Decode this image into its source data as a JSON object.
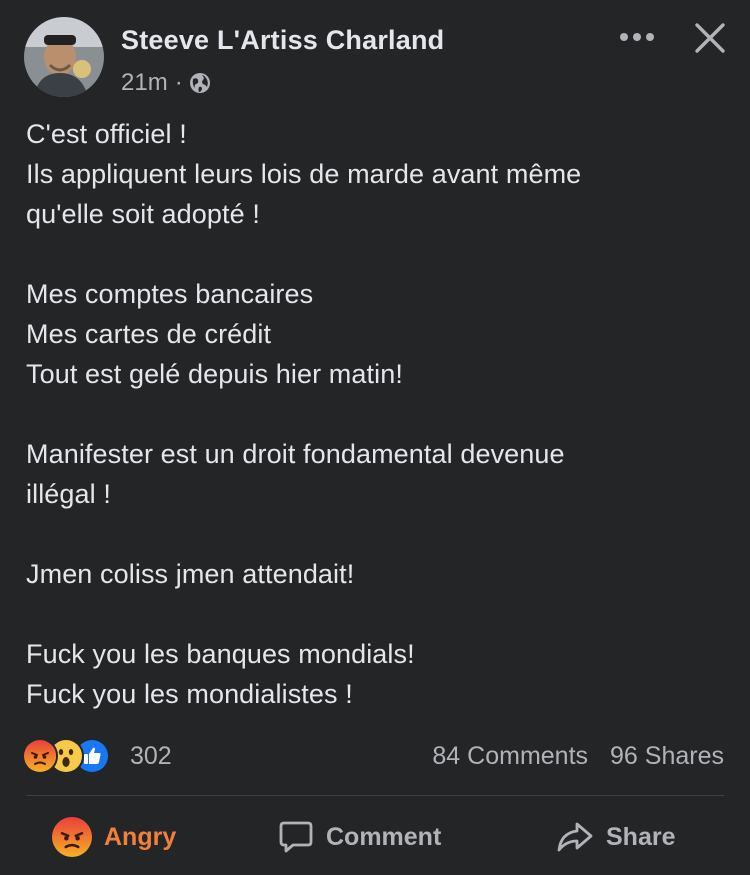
{
  "post": {
    "author": "Steeve L'Artiss Charland",
    "time": "21m",
    "separator": "·",
    "privacy_icon": "globe-icon",
    "lines": [
      "C'est officiel !",
      "Ils appliquent leurs lois de marde avant même",
      "qu'elle soit adopté !",
      "",
      "Mes comptes bancaires",
      "Mes cartes de crédit",
      "Tout est gelé depuis hier matin!",
      "",
      "Manifester est un droit fondamental devenue",
      "illégal !",
      "",
      "Jmen coliss jmen attendait!",
      "",
      "Fuck you les banques mondials!",
      "Fuck you les mondialistes !"
    ]
  },
  "engagement": {
    "reaction_icons": [
      "angry-reaction-icon",
      "wow-reaction-icon",
      "like-reaction-icon"
    ],
    "reaction_count": "302",
    "comments": "84 Comments",
    "shares": "96 Shares"
  },
  "actions": {
    "angry_label": "Angry",
    "comment_label": "Comment",
    "share_label": "Share"
  },
  "colors": {
    "background": "#242526",
    "text_primary": "#e4e6eb",
    "text_secondary": "#b0b3b8",
    "angry_accent": "#f0803c",
    "like_blue": "#1877f2",
    "divider": "#3e4042"
  }
}
